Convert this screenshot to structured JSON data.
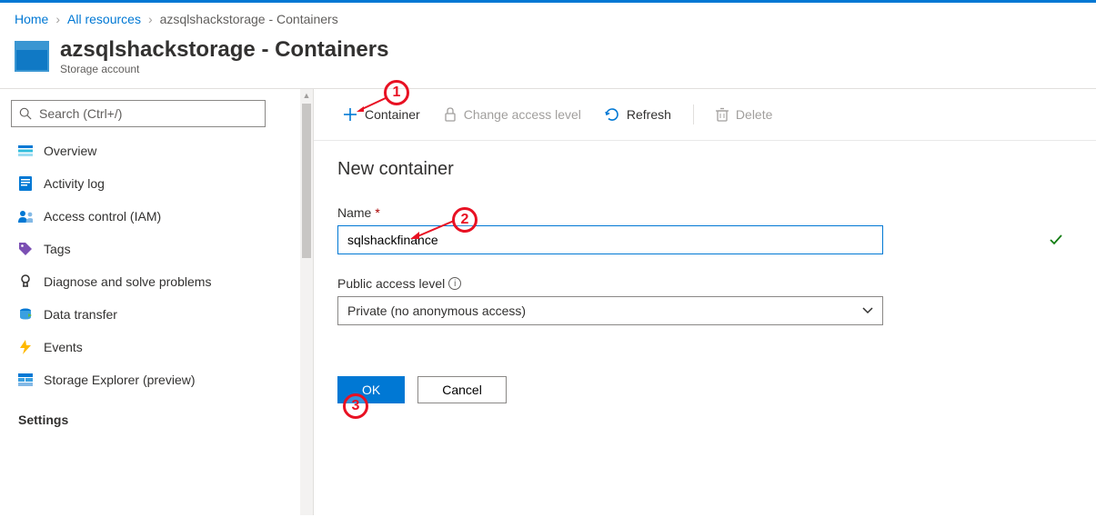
{
  "breadcrumb": {
    "home": "Home",
    "all_resources": "All resources",
    "current": "azsqlshackstorage - Containers"
  },
  "header": {
    "title": "azsqlshackstorage - Containers",
    "subtitle": "Storage account"
  },
  "search": {
    "placeholder": "Search (Ctrl+/)"
  },
  "nav": {
    "items": [
      {
        "key": "overview",
        "label": "Overview"
      },
      {
        "key": "activitylog",
        "label": "Activity log"
      },
      {
        "key": "iam",
        "label": "Access control (IAM)"
      },
      {
        "key": "tags",
        "label": "Tags"
      },
      {
        "key": "diagnose",
        "label": "Diagnose and solve problems"
      },
      {
        "key": "datatransfer",
        "label": "Data transfer"
      },
      {
        "key": "events",
        "label": "Events"
      },
      {
        "key": "storageexplorer",
        "label": "Storage Explorer (preview)"
      }
    ],
    "section": "Settings"
  },
  "toolbar": {
    "container": "Container",
    "change_access": "Change access level",
    "refresh": "Refresh",
    "delete": "Delete"
  },
  "form": {
    "title": "New container",
    "name_label": "Name",
    "name_value": "sqlshackfinance",
    "access_label": "Public access level",
    "access_value": "Private (no anonymous access)",
    "ok": "OK",
    "cancel": "Cancel"
  },
  "anno": {
    "one": "1",
    "two": "2",
    "three": "3"
  }
}
